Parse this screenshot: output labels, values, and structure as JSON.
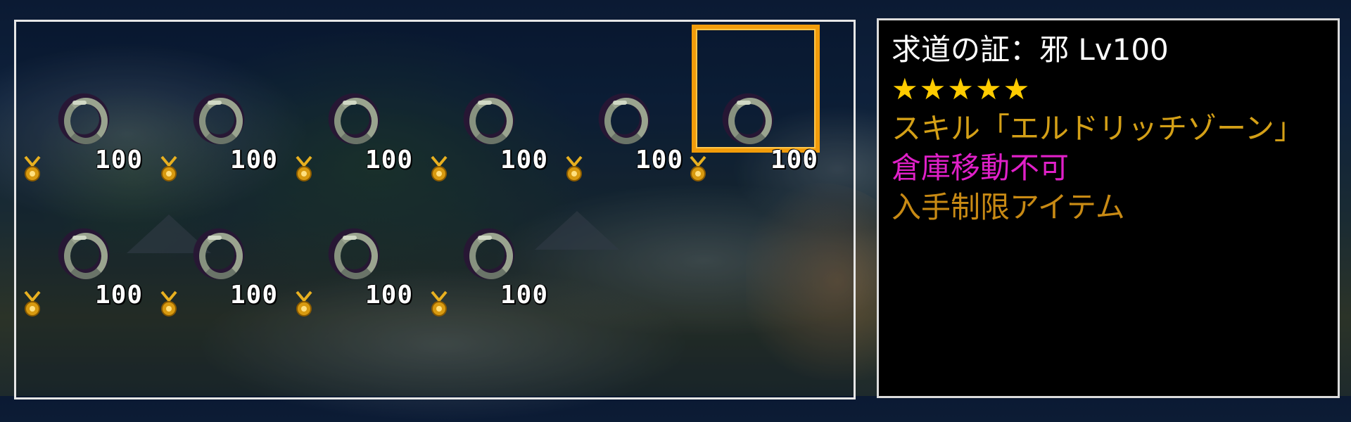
{
  "item": {
    "title": "求道の証：邪 Lv100",
    "stars": "★★★★★",
    "skill_text": "スキル「エルドリッチゾーン」",
    "storage_note": "倉庫移動不可",
    "acquisition_note": "入手制限アイテム"
  },
  "inventory": {
    "slots": [
      {
        "count": "100",
        "icon": "ring-icon",
        "badge_icon": "medal-icon"
      },
      {
        "count": "100",
        "icon": "ring-icon",
        "badge_icon": "medal-icon"
      },
      {
        "count": "100",
        "icon": "ring-icon",
        "badge_icon": "medal-icon"
      },
      {
        "count": "100",
        "icon": "ring-icon",
        "badge_icon": "medal-icon"
      },
      {
        "count": "100",
        "icon": "ring-icon",
        "badge_icon": "medal-icon"
      },
      {
        "count": "100",
        "icon": "ring-icon",
        "badge_icon": "medal-icon",
        "selected": true
      },
      {
        "count": "100",
        "icon": "ring-icon",
        "badge_icon": "medal-icon"
      },
      {
        "count": "100",
        "icon": "ring-icon",
        "badge_icon": "medal-icon"
      },
      {
        "count": "100",
        "icon": "ring-icon",
        "badge_icon": "medal-icon"
      },
      {
        "count": "100",
        "icon": "ring-icon",
        "badge_icon": "medal-icon"
      }
    ]
  },
  "colors": {
    "selection": "#f29c0a",
    "stars": "#ffcc00",
    "skill": "#d4a017",
    "storage_note": "#e020c8",
    "acquisition_note": "#c88a14"
  }
}
